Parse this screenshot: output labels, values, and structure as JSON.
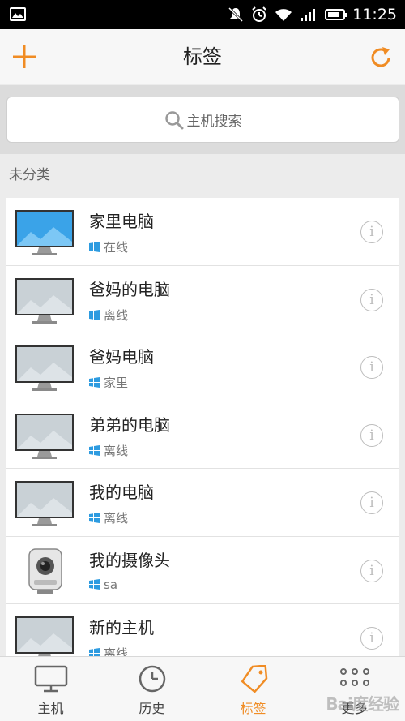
{
  "status_bar": {
    "time": "11:25",
    "icons": [
      "image-icon",
      "notification-off-icon",
      "alarm-icon",
      "wifi-icon",
      "signal-icon",
      "battery-icon"
    ]
  },
  "header": {
    "title": "标签",
    "add_icon": "plus-icon",
    "refresh_icon": "refresh-icon",
    "accent_color": "#f08c24"
  },
  "search": {
    "placeholder": "主机搜索",
    "icon": "search-icon"
  },
  "section": {
    "label": "未分类"
  },
  "hosts": [
    {
      "name": "家里电脑",
      "status": "在线",
      "device": "monitor",
      "online": true
    },
    {
      "name": "爸妈的电脑",
      "status": "离线",
      "device": "monitor",
      "online": false
    },
    {
      "name": "爸妈电脑",
      "status": "家里",
      "device": "monitor",
      "online": false
    },
    {
      "name": "弟弟的电脑",
      "status": "离线",
      "device": "monitor",
      "online": false
    },
    {
      "name": "我的电脑",
      "status": "离线",
      "device": "monitor",
      "online": false
    },
    {
      "name": "我的摄像头",
      "status": "sa",
      "device": "camera",
      "online": false
    },
    {
      "name": "新的主机",
      "status": "离线",
      "device": "monitor",
      "online": false
    }
  ],
  "info_glyph": "i",
  "bottom_nav": [
    {
      "label": "主机",
      "icon": "monitor-icon",
      "active": false
    },
    {
      "label": "历史",
      "icon": "clock-icon",
      "active": false
    },
    {
      "label": "标签",
      "icon": "tag-icon",
      "active": true
    },
    {
      "label": "更多",
      "icon": "more-icon",
      "active": false
    }
  ],
  "watermark": "Bai度经验"
}
